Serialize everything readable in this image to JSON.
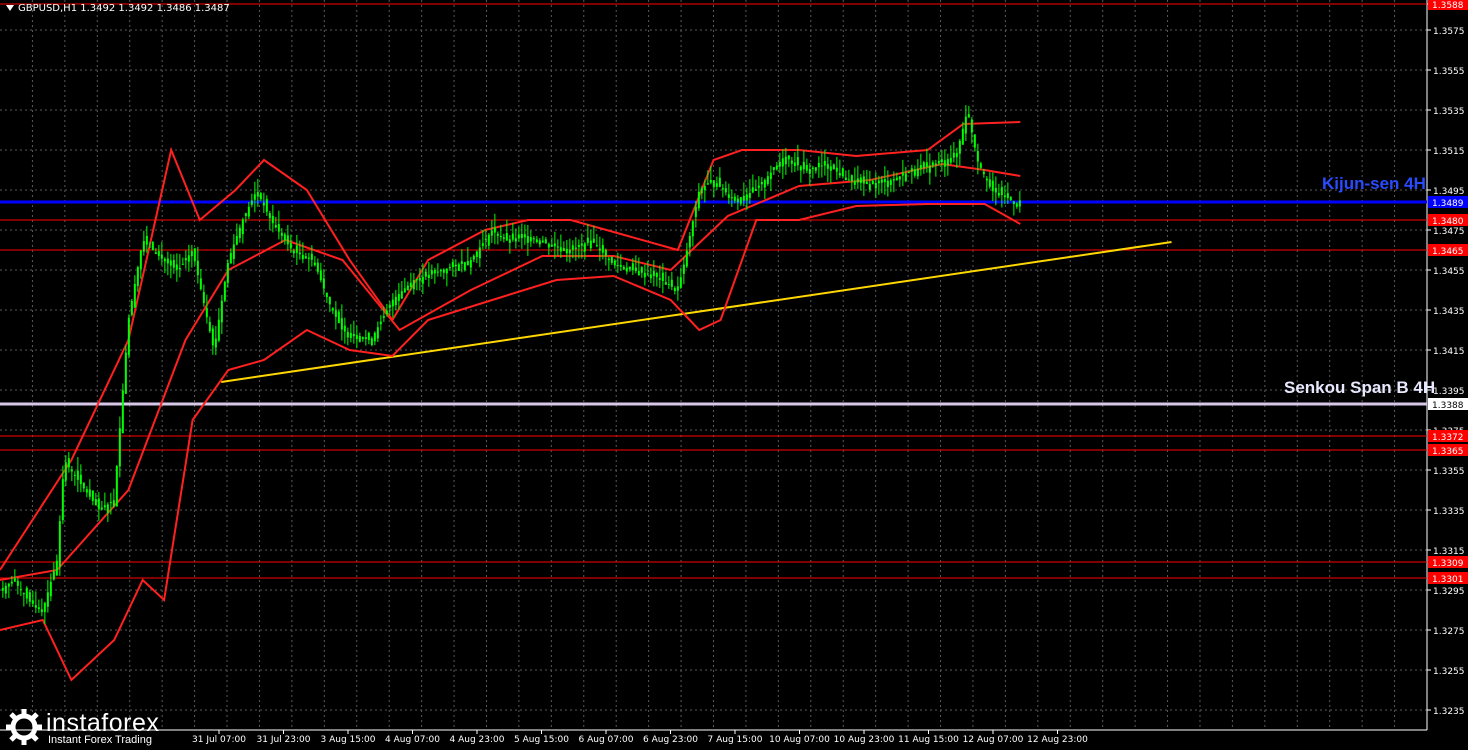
{
  "header": {
    "symbol_line": "GBPUSD,H1  1.3492 1.3492 1.3486 1.3487"
  },
  "watermark": {
    "brand": "instaforex",
    "tagline": "Instant Forex Trading"
  },
  "colors": {
    "background": "#000000",
    "grid": "#5a5a5a",
    "candle": "#00ff00",
    "bands": "#ff2020",
    "kijun": "#0000ff",
    "senkou": "#ffffff",
    "level": "#ff0000",
    "trendline": "#ffd700"
  },
  "chart_data": {
    "type": "candlestick",
    "symbol": "GBPUSD",
    "timeframe": "H1",
    "ylim": [
      1.3225,
      1.359
    ],
    "y_ticks": [
      "1.3588",
      "1.3575",
      "1.3555",
      "1.3535",
      "1.3515",
      "1.3495",
      "1.3475",
      "1.3455",
      "1.3435",
      "1.3415",
      "1.3395",
      "1.3375",
      "1.3355",
      "1.3335",
      "1.3315",
      "1.3295",
      "1.3275",
      "1.3255",
      "1.3235"
    ],
    "x_ticks": [
      "31 Jul 07:00",
      "31 Jul 23:00",
      "3 Aug 15:00",
      "4 Aug 07:00",
      "4 Aug 23:00",
      "5 Aug 15:00",
      "6 Aug 07:00",
      "6 Aug 23:00",
      "7 Aug 15:00",
      "10 Aug 07:00",
      "10 Aug 23:00",
      "11 Aug 15:00",
      "12 Aug 07:00",
      "12 Aug 23:00"
    ],
    "levels": [
      {
        "value": 1.3588,
        "label": "1.3588"
      },
      {
        "value": 1.348,
        "label": "1.3480"
      },
      {
        "value": 1.3465,
        "label": "1.3465"
      },
      {
        "value": 1.3372,
        "label": "1.3372"
      },
      {
        "value": 1.3365,
        "label": "1.3365"
      },
      {
        "value": 1.3309,
        "label": "1.3309"
      },
      {
        "value": 1.3301,
        "label": "1.3301"
      }
    ],
    "kijun": {
      "value": 1.3489,
      "label": "1.3489",
      "name": "Kijun-sen 4H"
    },
    "senkou": {
      "value": 1.3388,
      "label": "1.3388",
      "name": "Senkou Span B 4H"
    },
    "trendline": {
      "from": [
        0.155,
        1.3399
      ],
      "to": [
        0.821,
        1.3469
      ]
    },
    "price_path": [
      [
        0.0,
        1.3295
      ],
      [
        0.01,
        1.33
      ],
      [
        0.02,
        1.329
      ],
      [
        0.03,
        1.3285
      ],
      [
        0.04,
        1.331
      ],
      [
        0.045,
        1.336
      ],
      [
        0.055,
        1.335
      ],
      [
        0.07,
        1.3335
      ],
      [
        0.08,
        1.334
      ],
      [
        0.09,
        1.343
      ],
      [
        0.1,
        1.347
      ],
      [
        0.115,
        1.346
      ],
      [
        0.125,
        1.3455
      ],
      [
        0.135,
        1.3465
      ],
      [
        0.15,
        1.3415
      ],
      [
        0.16,
        1.346
      ],
      [
        0.17,
        1.348
      ],
      [
        0.18,
        1.3495
      ],
      [
        0.19,
        1.348
      ],
      [
        0.205,
        1.3465
      ],
      [
        0.22,
        1.346
      ],
      [
        0.23,
        1.344
      ],
      [
        0.24,
        1.3425
      ],
      [
        0.26,
        1.342
      ],
      [
        0.275,
        1.344
      ],
      [
        0.29,
        1.345
      ],
      [
        0.31,
        1.3455
      ],
      [
        0.33,
        1.346
      ],
      [
        0.345,
        1.3475
      ],
      [
        0.355,
        1.347
      ],
      [
        0.37,
        1.3472
      ],
      [
        0.385,
        1.3468
      ],
      [
        0.4,
        1.3465
      ],
      [
        0.415,
        1.347
      ],
      [
        0.43,
        1.3458
      ],
      [
        0.445,
        1.3455
      ],
      [
        0.46,
        1.3452
      ],
      [
        0.475,
        1.3445
      ],
      [
        0.48,
        1.346
      ],
      [
        0.49,
        1.3495
      ],
      [
        0.5,
        1.35
      ],
      [
        0.515,
        1.349
      ],
      [
        0.53,
        1.3495
      ],
      [
        0.55,
        1.3512
      ],
      [
        0.565,
        1.3505
      ],
      [
        0.58,
        1.3508
      ],
      [
        0.595,
        1.35
      ],
      [
        0.61,
        1.3498
      ],
      [
        0.625,
        1.35
      ],
      [
        0.64,
        1.3505
      ],
      [
        0.655,
        1.3508
      ],
      [
        0.67,
        1.3512
      ],
      [
        0.678,
        1.3535
      ],
      [
        0.685,
        1.351
      ],
      [
        0.695,
        1.3495
      ],
      [
        0.705,
        1.3492
      ],
      [
        0.715,
        1.3487
      ]
    ],
    "middle_band": [
      [
        0.0,
        1.33
      ],
      [
        0.04,
        1.3305
      ],
      [
        0.09,
        1.3345
      ],
      [
        0.13,
        1.342
      ],
      [
        0.16,
        1.3455
      ],
      [
        0.2,
        1.347
      ],
      [
        0.24,
        1.346
      ],
      [
        0.28,
        1.3425
      ],
      [
        0.33,
        1.3445
      ],
      [
        0.38,
        1.3462
      ],
      [
        0.43,
        1.3462
      ],
      [
        0.47,
        1.3455
      ],
      [
        0.51,
        1.3482
      ],
      [
        0.56,
        1.3497
      ],
      [
        0.61,
        1.35
      ],
      [
        0.66,
        1.3508
      ],
      [
        0.69,
        1.3505
      ],
      [
        0.715,
        1.3502
      ]
    ],
    "upper_band": [
      [
        0.0,
        1.3305
      ],
      [
        0.05,
        1.336
      ],
      [
        0.09,
        1.342
      ],
      [
        0.12,
        1.3515
      ],
      [
        0.14,
        1.348
      ],
      [
        0.165,
        1.3495
      ],
      [
        0.185,
        1.351
      ],
      [
        0.215,
        1.3495
      ],
      [
        0.245,
        1.346
      ],
      [
        0.275,
        1.343
      ],
      [
        0.3,
        1.346
      ],
      [
        0.34,
        1.3475
      ],
      [
        0.37,
        1.348
      ],
      [
        0.4,
        1.348
      ],
      [
        0.44,
        1.3472
      ],
      [
        0.475,
        1.3465
      ],
      [
        0.5,
        1.351
      ],
      [
        0.52,
        1.3515
      ],
      [
        0.56,
        1.3515
      ],
      [
        0.6,
        1.3512
      ],
      [
        0.65,
        1.3515
      ],
      [
        0.675,
        1.3528
      ],
      [
        0.715,
        1.3529
      ]
    ],
    "lower_band": [
      [
        0.0,
        1.3275
      ],
      [
        0.03,
        1.328
      ],
      [
        0.05,
        1.325
      ],
      [
        0.08,
        1.327
      ],
      [
        0.1,
        1.33
      ],
      [
        0.115,
        1.329
      ],
      [
        0.135,
        1.338
      ],
      [
        0.16,
        1.3405
      ],
      [
        0.185,
        1.341
      ],
      [
        0.215,
        1.3425
      ],
      [
        0.245,
        1.3415
      ],
      [
        0.275,
        1.3412
      ],
      [
        0.3,
        1.343
      ],
      [
        0.345,
        1.344
      ],
      [
        0.39,
        1.345
      ],
      [
        0.43,
        1.3452
      ],
      [
        0.47,
        1.344
      ],
      [
        0.49,
        1.3425
      ],
      [
        0.505,
        1.343
      ],
      [
        0.53,
        1.348
      ],
      [
        0.56,
        1.348
      ],
      [
        0.6,
        1.3487
      ],
      [
        0.65,
        1.3488
      ],
      [
        0.69,
        1.3488
      ],
      [
        0.715,
        1.3478
      ]
    ]
  }
}
